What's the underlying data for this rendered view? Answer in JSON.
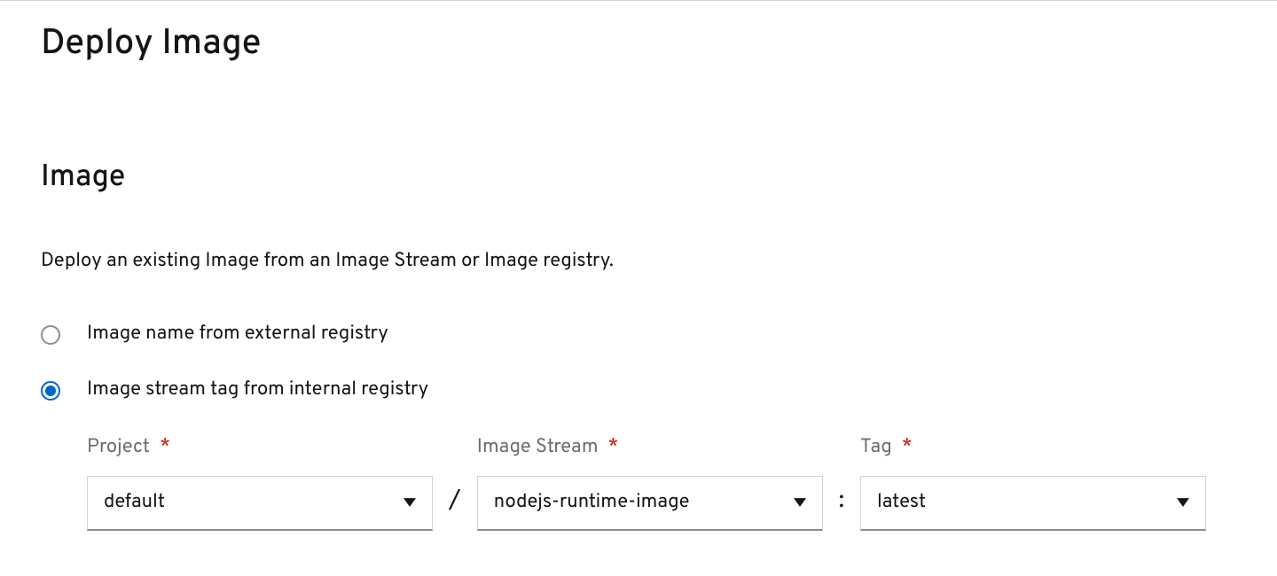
{
  "page": {
    "title": "Deploy Image"
  },
  "image_section": {
    "heading": "Image",
    "description": "Deploy an existing Image from an Image Stream or Image registry.",
    "radios": {
      "external": "Image name from external registry",
      "internal": "Image stream tag from internal registry"
    },
    "selected_radio": "internal",
    "fields": {
      "project": {
        "label": "Project",
        "value": "default"
      },
      "image_stream": {
        "label": "Image Stream",
        "value": "nodejs-runtime-image"
      },
      "tag": {
        "label": "Tag",
        "value": "latest"
      },
      "required_marker": "*"
    },
    "separators": {
      "slash": "/",
      "colon": ":"
    }
  }
}
